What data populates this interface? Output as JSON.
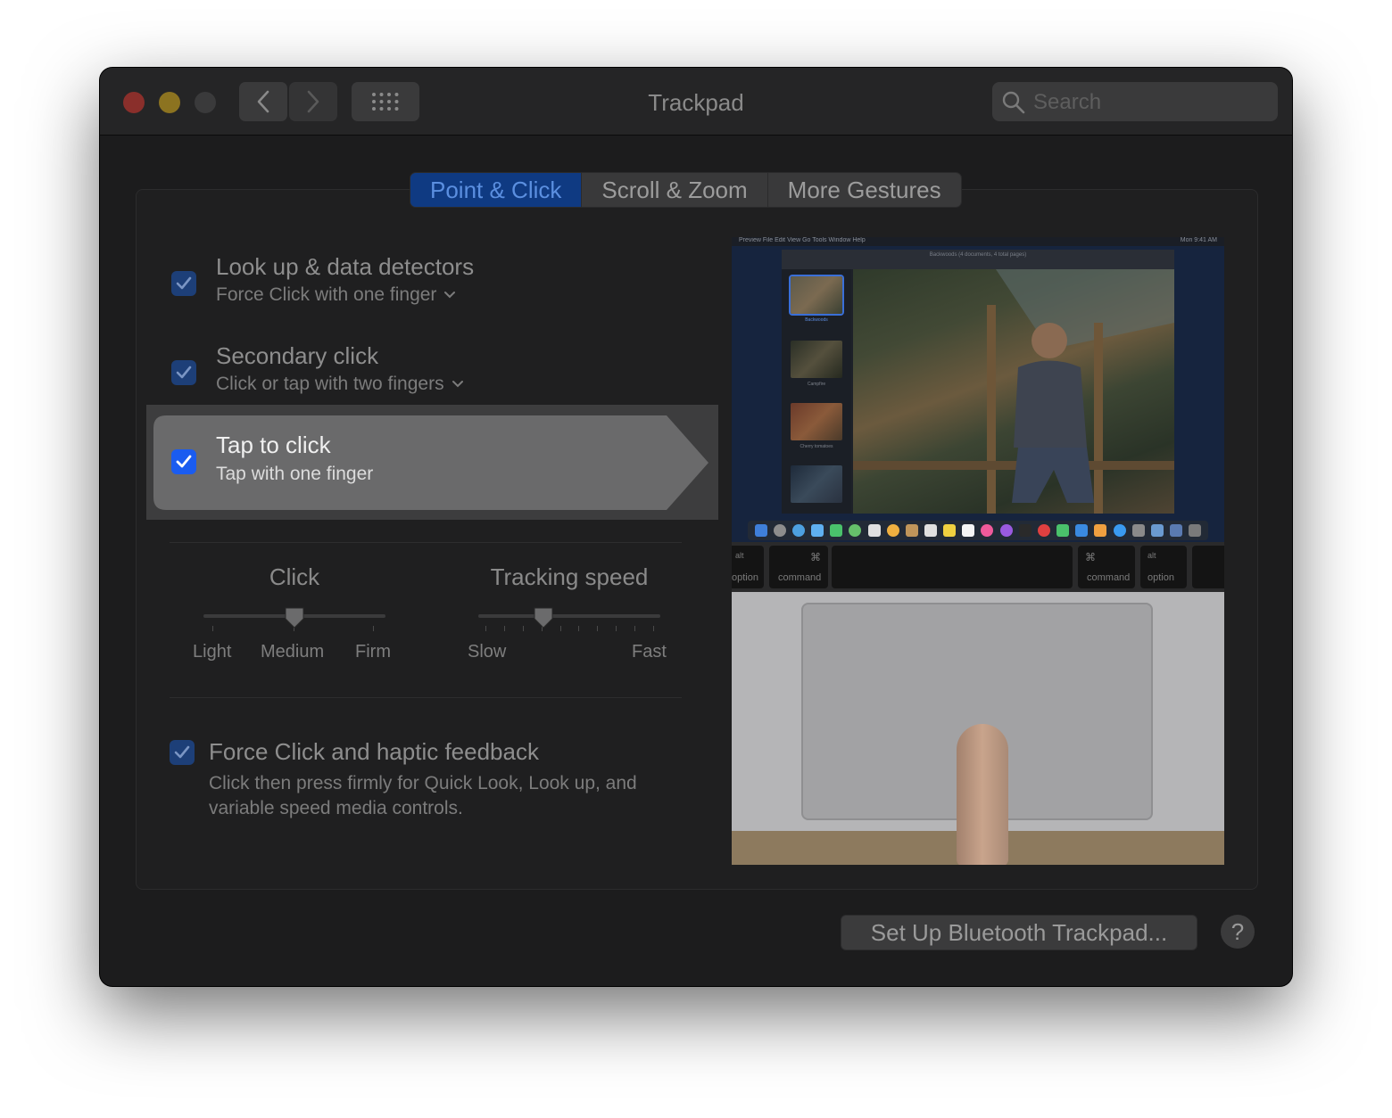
{
  "window": {
    "title": "Trackpad"
  },
  "search": {
    "placeholder": "Search",
    "value": ""
  },
  "tabs": [
    {
      "label": "Point & Click",
      "active": true
    },
    {
      "label": "Scroll & Zoom",
      "active": false
    },
    {
      "label": "More Gestures",
      "active": false
    }
  ],
  "options": [
    {
      "title": "Look up & data detectors",
      "subtitle": "Force Click with one finger",
      "checked": true,
      "has_dropdown": true
    },
    {
      "title": "Secondary click",
      "subtitle": "Click or tap with two fingers",
      "checked": true,
      "has_dropdown": true
    },
    {
      "title": "Tap to click",
      "subtitle": "Tap with one finger",
      "checked": true,
      "selected": true
    }
  ],
  "sliders": {
    "click": {
      "title": "Click",
      "labels": [
        "Light",
        "Medium",
        "Firm"
      ],
      "value": "Medium"
    },
    "tracking": {
      "title": "Tracking speed",
      "min_label": "Slow",
      "max_label": "Fast",
      "value_fraction": 0.36
    }
  },
  "force_click": {
    "title": "Force Click and haptic feedback",
    "description": "Click then press firmly for Quick Look, Look up, and variable speed media controls.",
    "checked": true
  },
  "preview": {
    "menubar": "Preview   File   Edit   View   Go   Tools   Window   Help",
    "menubar_right": "Mon 9:41 AM",
    "doc_title": "Backwoods (4 documents, 4 total pages)",
    "thumbs": [
      "Backwoods",
      "Campfire",
      "Cherry tomatoes"
    ],
    "keys": {
      "option_left": "option",
      "alt_left": "alt",
      "command_left": "command",
      "cmd_symbol": "⌘",
      "command_right": "command",
      "alt_right": "alt",
      "option_right": "option"
    }
  },
  "buttons": {
    "bluetooth": "Set Up Bluetooth Trackpad...",
    "help": "?"
  },
  "colors": {
    "accent": "#1a5cf0",
    "active_tab": "#0f3a82",
    "window_bg": "#1c1c1d"
  }
}
